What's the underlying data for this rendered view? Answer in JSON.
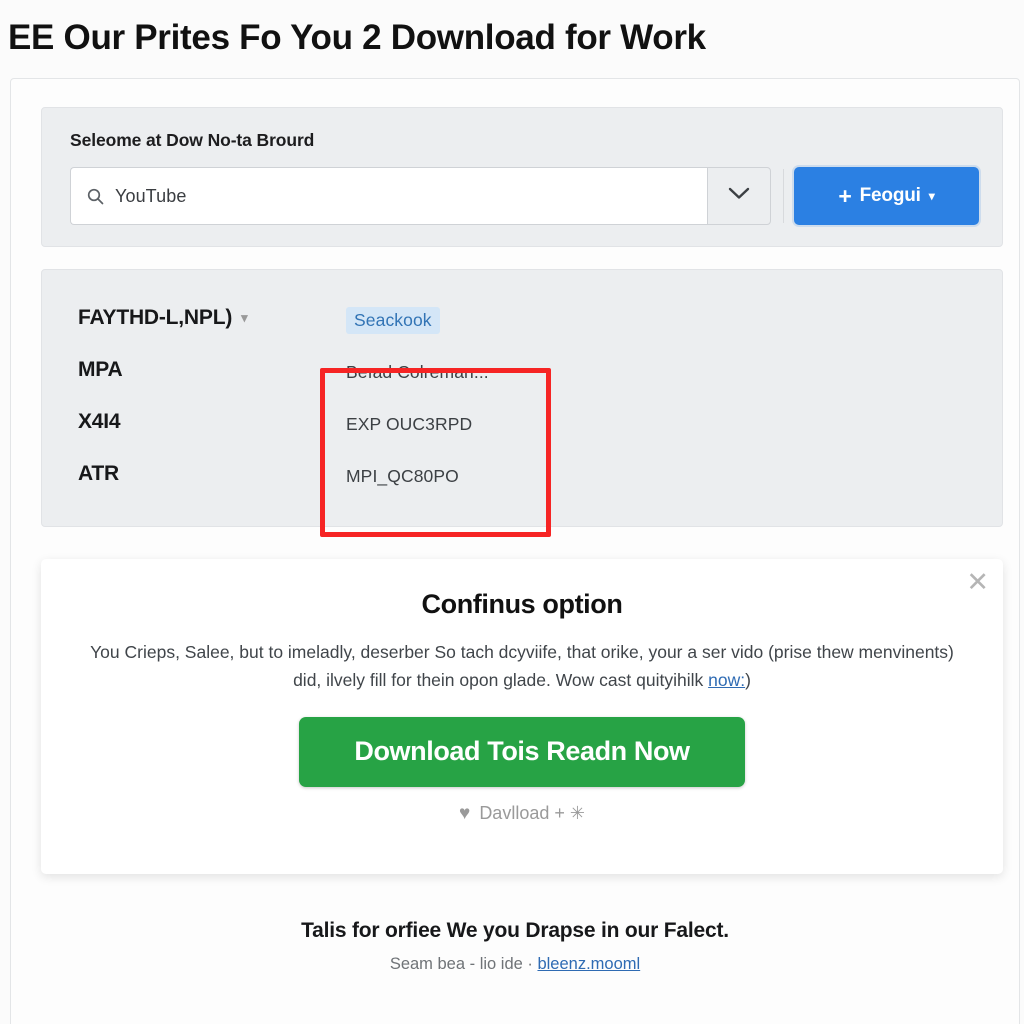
{
  "page": {
    "title": "EE Our Prites Fo You 2 Download for Work"
  },
  "search_panel": {
    "heading": "Seleome at Dow No-ta Brourd",
    "input_value": "YouTube",
    "input_placeholder": "YouTube",
    "search_icon": "search-icon",
    "dropdown_icon": "chevron-down-icon",
    "primary_button": {
      "plus": "+",
      "label": "Feogui",
      "caret": "▾"
    }
  },
  "list_panel": {
    "left_items": [
      {
        "label": "FAYTHD-L,NPL)",
        "caret": "▾"
      },
      {
        "label": "MPA",
        "caret": ""
      },
      {
        "label": "X4I4",
        "caret": ""
      },
      {
        "label": "ATR",
        "caret": ""
      }
    ],
    "right_items": [
      {
        "label": "Seackook",
        "highlighted": true
      },
      {
        "label": "Beıad Colreman.:.",
        "highlighted": false
      },
      {
        "label": "EXP OUC3RPD",
        "highlighted": false
      },
      {
        "label": "MPI_QC80PO",
        "highlighted": false
      }
    ]
  },
  "modal": {
    "close_label": "✕",
    "title": "Confinus option",
    "body_part1": "You Crieps, Salee, but to imeladly, deserber So tach dcyviife, that orike, your a ser vido (prise thew menvinents) did, ilvely fill for thein opon glade. Wow cast quityihilk ",
    "body_link": "now:",
    "body_part2": ")",
    "cta_label": "Download Tois Readn Now",
    "fav_heart": "♥",
    "fav_label": "Davlload + ✳"
  },
  "footer": {
    "title": "Talis for orfiee We you Drapse in our Falect.",
    "sub_prefix": "Seam bea - lio ide · ",
    "link": "bleenz.mooml"
  },
  "colors": {
    "primary_blue": "#2b80e3",
    "cta_green": "#27a345",
    "highlight_red": "#f62424",
    "chip_bg": "#d4e6f7",
    "chip_text": "#3274b5",
    "link_blue": "#2f6bb3"
  }
}
